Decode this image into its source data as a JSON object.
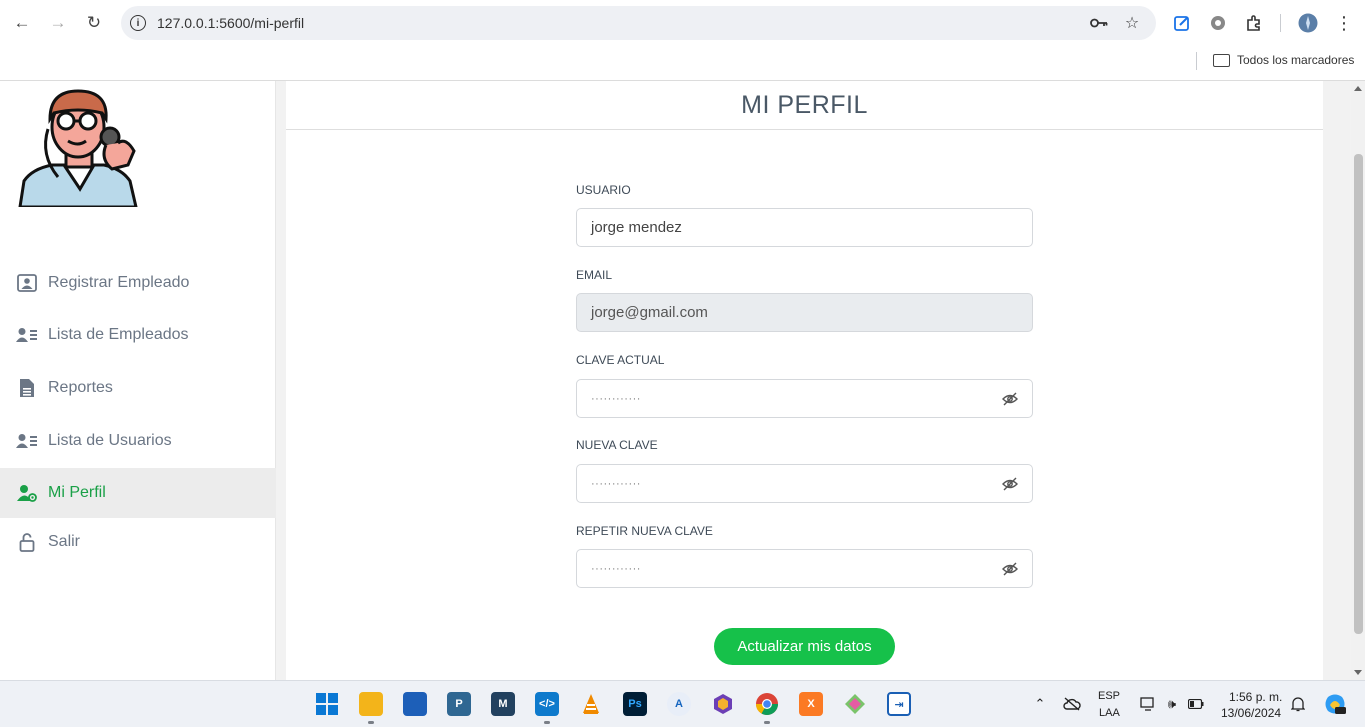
{
  "browser": {
    "url": "127.0.0.1:5600/mi-perfil",
    "bookmarks_folder": "Todos los marcadores"
  },
  "sidebar": {
    "items": [
      {
        "label": "Registrar Empleado",
        "icon": "user-badge-icon",
        "active": false
      },
      {
        "label": "Lista de Empleados",
        "icon": "user-list-icon",
        "active": false
      },
      {
        "label": "Reportes",
        "icon": "report-file-icon",
        "active": false
      },
      {
        "label": "Lista de Usuarios",
        "icon": "user-list-icon",
        "active": false
      },
      {
        "label": "Mi Perfil",
        "icon": "user-gear-icon",
        "active": true
      },
      {
        "label": "Salir",
        "icon": "lock-open-icon",
        "active": false
      }
    ]
  },
  "main": {
    "title": "MI PERFIL",
    "form": {
      "usuario_label": "USUARIO",
      "usuario_value": "jorge mendez",
      "email_label": "EMAIL",
      "email_value": "jorge@gmail.com",
      "clave_actual_label": "CLAVE ACTUAL",
      "clave_actual_value": "············",
      "nueva_clave_label": "NUEVA CLAVE",
      "nueva_clave_value": "············",
      "repetir_label": "REPETIR NUEVA CLAVE",
      "repetir_value": "············",
      "submit_label": "Actualizar mis datos"
    }
  },
  "taskbar": {
    "lang_top": "ESP",
    "lang_bottom": "LAA",
    "time": "1:56 p. m.",
    "date": "13/06/2024"
  },
  "colors": {
    "accent_green": "#16c14a",
    "active_text": "#1aa047",
    "muted_text": "#6b7685"
  }
}
